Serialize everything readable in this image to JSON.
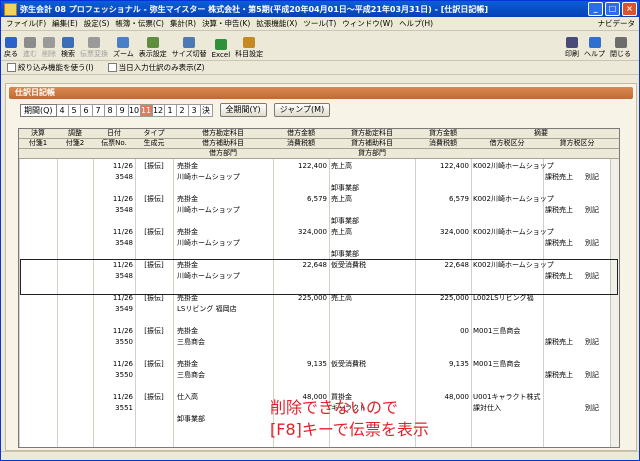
{
  "title": "弥生会計 08 プロフェッショナル - 弥生マイスター 株式会社・第5期(平成20年04月01日～平成21年03月31日) - [仕訳日記帳]",
  "menu": [
    "ファイル(F)",
    "編集(E)",
    "設定(S)",
    "帳簿・伝票(C)",
    "集計(R)",
    "決算・申告(K)",
    "拡張機能(X)",
    "ツール(T)",
    "ウィンドウ(W)",
    "ヘルプ(H)"
  ],
  "navi_label": "ナビデータ",
  "toolbar": {
    "left": [
      {
        "label": "戻る",
        "icon": "back-arrow-icon",
        "enabled": true
      },
      {
        "label": "進む",
        "icon": "forward-arrow-icon",
        "enabled": false
      },
      {
        "label": "削除",
        "icon": "trash-icon",
        "enabled": false
      },
      {
        "label": "検索",
        "icon": "magnifier-icon",
        "enabled": true
      },
      {
        "label": "伝票変換",
        "icon": "voucher-icon",
        "enabled": false
      },
      {
        "label": "ズーム",
        "icon": "zoom-icon",
        "enabled": true
      },
      {
        "label": "表示設定",
        "icon": "display-settings-icon",
        "enabled": true
      },
      {
        "label": "サイズ切替",
        "icon": "resize-icon",
        "enabled": true
      },
      {
        "label": "Excel",
        "icon": "excel-icon",
        "enabled": true
      },
      {
        "label": "科目設定",
        "icon": "account-settings-icon",
        "enabled": true
      }
    ],
    "right": [
      {
        "label": "印刷",
        "icon": "printer-icon",
        "enabled": true
      },
      {
        "label": "ヘルプ",
        "icon": "help-icon",
        "enabled": true
      },
      {
        "label": "閉じる",
        "icon": "close-window-icon",
        "enabled": true
      }
    ]
  },
  "options": {
    "filter": "絞り込み機能を使う(I)",
    "today": "当日入力仕訳のみ表示(Z)"
  },
  "section_title": "仕訳日記帳",
  "period": {
    "label": "期間(Q)",
    "months": [
      "4",
      "5",
      "6",
      "7",
      "8",
      "9",
      "10",
      "11",
      "12",
      "1",
      "2",
      "3",
      "決"
    ],
    "active": "11",
    "all_button": "全期間(Y)",
    "jump_button": "ジャンプ(M)"
  },
  "header": {
    "row1": [
      "決算",
      "調整",
      "日付",
      "タイプ",
      "借方勘定科目",
      "借方金額",
      "貸方勘定科目",
      "貸方金額",
      "摘要"
    ],
    "row2": [
      "付箋1",
      "付箋2",
      "伝票No.",
      "生成元",
      "借方補助科目",
      "消費税額",
      "貸方補助科目",
      "消費税額",
      "借方税区分",
      "貸方税区分"
    ],
    "row3": [
      "借方部門",
      "貸方部門"
    ]
  },
  "entries": [
    {
      "date": "11/26",
      "no": "3548",
      "type": "[振伝]",
      "debit": "売掛金",
      "debit_sub": "川崎ホームショップ",
      "debit_amt": "122,400",
      "credit": "売上高",
      "credit_sub": "",
      "credit_dept": "卸事業部",
      "credit_amt": "122,400",
      "memo": "K002川崎ホームショップ",
      "dtax": "",
      "ctax": "課税売上",
      "ctax2": "別記",
      "selected": false
    },
    {
      "date": "11/26",
      "no": "3548",
      "type": "[振伝]",
      "debit": "売掛金",
      "debit_sub": "川崎ホームショップ",
      "debit_amt": "6,579",
      "credit": "売上高",
      "credit_sub": "",
      "credit_dept": "卸事業部",
      "credit_amt": "6,579",
      "memo": "K002川崎ホームショップ",
      "dtax": "",
      "ctax": "課税売上",
      "ctax2": "別記",
      "selected": false
    },
    {
      "date": "11/26",
      "no": "3548",
      "type": "[振伝]",
      "debit": "売掛金",
      "debit_sub": "川崎ホームショップ",
      "debit_amt": "324,000",
      "credit": "売上高",
      "credit_sub": "",
      "credit_dept": "卸事業部",
      "credit_amt": "324,000",
      "memo": "K002川崎ホームショップ",
      "dtax": "",
      "ctax": "課税売上",
      "ctax2": "別記",
      "selected": false
    },
    {
      "date": "11/26",
      "no": "3548",
      "type": "[振伝]",
      "debit": "売掛金",
      "debit_sub": "川崎ホームショップ",
      "debit_amt": "22,648",
      "credit": "仮受消費税",
      "credit_sub": "",
      "credit_dept": "",
      "credit_amt": "22,648",
      "memo": "K002川崎ホームショップ",
      "dtax": "",
      "ctax": "課税売上",
      "ctax2": "別記",
      "selected": true
    },
    {
      "date": "11/26",
      "no": "3549",
      "type": "[振伝]",
      "debit": "売掛金",
      "debit_sub": "LSリビング 福岡店",
      "debit_amt": "225,000",
      "credit": "売上高",
      "credit_sub": "",
      "credit_dept": "",
      "credit_amt": "225,000",
      "memo": "L002LSリビング福",
      "dtax": "",
      "ctax": "",
      "ctax2": "",
      "selected": false
    },
    {
      "date": "11/26",
      "no": "3550",
      "type": "[振伝]",
      "debit": "売掛金",
      "debit_sub": "三島商会",
      "debit_amt": "",
      "credit": "",
      "credit_sub": "",
      "credit_dept": "",
      "credit_amt": "00",
      "memo": "M001三島商会",
      "dtax": "",
      "ctax": "課税売上",
      "ctax2": "別記",
      "selected": false
    },
    {
      "date": "11/26",
      "no": "3550",
      "type": "[振伝]",
      "debit": "売掛金",
      "debit_sub": "三島商会",
      "debit_amt": "9,135",
      "credit": "仮受消費税",
      "credit_sub": "",
      "credit_dept": "",
      "credit_amt": "9,135",
      "memo": "M001三島商会",
      "dtax": "",
      "ctax": "課税売上",
      "ctax2": "別記",
      "selected": false
    },
    {
      "date": "11/26",
      "no": "3551",
      "type": "[振伝]",
      "debit": "仕入高",
      "debit_sub": "",
      "debit_dept": "卸事業部",
      "debit_amt": "48,000",
      "credit": "買掛金",
      "credit_sub": "キャラクト",
      "credit_dept": "",
      "credit_amt": "48,000",
      "memo": "U001キャラクト株式",
      "dtax": "課対仕入",
      "ctax": "",
      "ctax2": "別記",
      "selected": false
    }
  ],
  "overlay": {
    "line1": "削除できないので",
    "line2": "[F8]キーで伝票を表示"
  },
  "colors": {
    "titlebar": "#0a5fd8",
    "section": "#c9783f",
    "active_month": "#e07a60",
    "overlay_text": "#e0222b"
  }
}
